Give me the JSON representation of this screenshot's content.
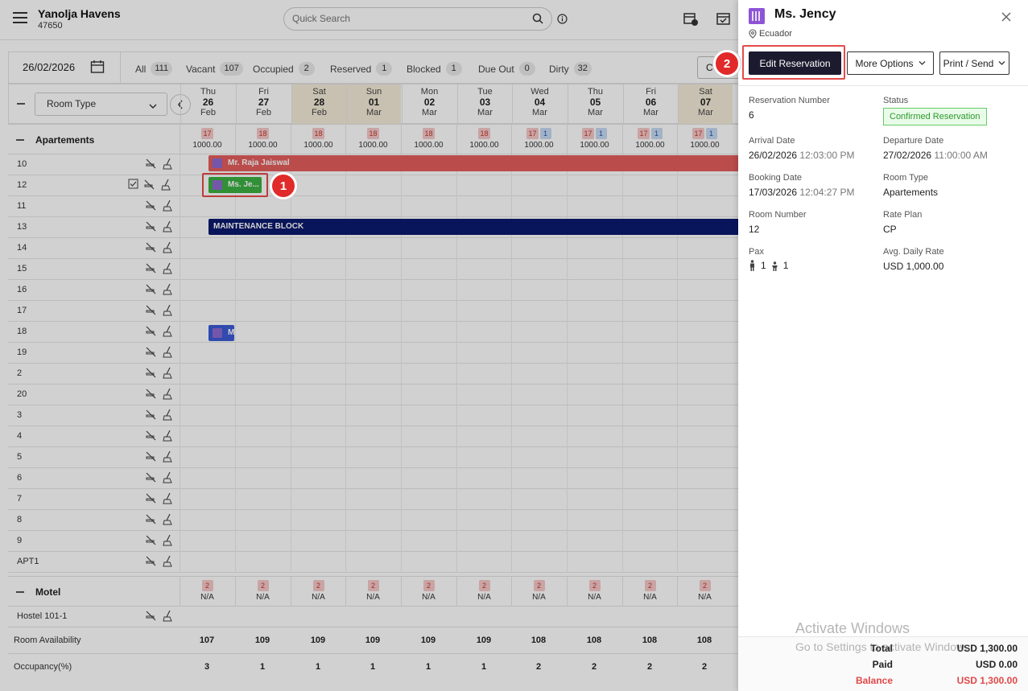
{
  "header": {
    "hotel_name": "Yanolja Havens",
    "hotel_code": "47650",
    "search_placeholder": "Quick Search"
  },
  "filters": {
    "date": "26/02/2026",
    "items": [
      {
        "label": "All",
        "count": "111"
      },
      {
        "label": "Vacant",
        "count": "107"
      },
      {
        "label": "Occupied",
        "count": "2"
      },
      {
        "label": "Reserved",
        "count": "1"
      },
      {
        "label": "Blocked",
        "count": "1"
      },
      {
        "label": "Due Out",
        "count": "0"
      },
      {
        "label": "Dirty",
        "count": "32"
      }
    ],
    "clipped_button": "C"
  },
  "grid": {
    "room_type_select": "Room Type",
    "dates": [
      {
        "dow": "Thu",
        "day": "26",
        "mon": "Feb"
      },
      {
        "dow": "Fri",
        "day": "27",
        "mon": "Feb"
      },
      {
        "dow": "Sat",
        "day": "28",
        "mon": "Feb"
      },
      {
        "dow": "Sun",
        "day": "01",
        "mon": "Mar"
      },
      {
        "dow": "Mon",
        "day": "02",
        "mon": "Mar"
      },
      {
        "dow": "Tue",
        "day": "03",
        "mon": "Mar"
      },
      {
        "dow": "Wed",
        "day": "04",
        "mon": "Mar"
      },
      {
        "dow": "Thu",
        "day": "05",
        "mon": "Mar"
      },
      {
        "dow": "Fri",
        "day": "06",
        "mon": "Mar"
      },
      {
        "dow": "Sat",
        "day": "07",
        "mon": "Mar"
      }
    ],
    "group1": {
      "name": "Apartements",
      "cells": [
        {
          "red": "17",
          "blue": "",
          "amt": "1000.00"
        },
        {
          "red": "18",
          "blue": "",
          "amt": "1000.00"
        },
        {
          "red": "18",
          "blue": "",
          "amt": "1000.00"
        },
        {
          "red": "18",
          "blue": "",
          "amt": "1000.00"
        },
        {
          "red": "18",
          "blue": "",
          "amt": "1000.00"
        },
        {
          "red": "18",
          "blue": "",
          "amt": "1000.00"
        },
        {
          "red": "17",
          "blue": "1",
          "amt": "1000.00"
        },
        {
          "red": "17",
          "blue": "1",
          "amt": "1000.00"
        },
        {
          "red": "17",
          "blue": "1",
          "amt": "1000.00"
        },
        {
          "red": "17",
          "blue": "1",
          "amt": "1000.00"
        }
      ]
    },
    "rooms": [
      "10",
      "12",
      "11",
      "13",
      "14",
      "15",
      "16",
      "17",
      "18",
      "19",
      "2",
      "20",
      "3",
      "4",
      "5",
      "6",
      "7",
      "8",
      "9",
      "APT1"
    ],
    "bookings": {
      "raja": "Mr. Raja Jaiswal",
      "jency": "Ms. Je...",
      "maintenance": "MAINTENANCE BLOCK",
      "room18": "M"
    },
    "group2": {
      "name": "Motel",
      "cells": [
        "2",
        "2",
        "2",
        "2",
        "2",
        "2",
        "2",
        "2",
        "2",
        "2"
      ],
      "value": "N/A"
    },
    "hostel_room": "Hostel 101-1",
    "availability_label": "Room Availability",
    "availability": [
      "107",
      "109",
      "109",
      "109",
      "109",
      "109",
      "108",
      "108",
      "108",
      "108"
    ],
    "occupancy_label": "Occupancy(%)",
    "occupancy": [
      "3",
      "1",
      "1",
      "1",
      "1",
      "1",
      "2",
      "2",
      "2",
      "2"
    ]
  },
  "panel": {
    "guest_name": "Ms. Jency",
    "country": "Ecuador",
    "buttons": {
      "edit": "Edit Reservation",
      "more": "More Options",
      "print": "Print / Send"
    },
    "fields": {
      "reservation_number_label": "Reservation Number",
      "reservation_number": "6",
      "status_label": "Status",
      "status": "Confirmed Reservation",
      "arrival_label": "Arrival Date",
      "arrival_date": "26/02/2026",
      "arrival_time": "12:03:00 PM",
      "departure_label": "Departure Date",
      "departure_date": "27/02/2026",
      "departure_time": "11:00:00 AM",
      "booking_label": "Booking Date",
      "booking_date": "17/03/2026",
      "booking_time": "12:04:27 PM",
      "room_type_label": "Room Type",
      "room_type": "Apartements",
      "room_number_label": "Room Number",
      "room_number": "12",
      "rate_plan_label": "Rate Plan",
      "rate_plan": "CP",
      "pax_label": "Pax",
      "pax_adults": "1",
      "pax_children": "1",
      "adr_label": "Avg. Daily Rate",
      "adr": "USD 1,000.00"
    },
    "totals": {
      "total_label": "Total",
      "total": "USD 1,300.00",
      "paid_label": "Paid",
      "paid": "USD 0.00",
      "balance_label": "Balance",
      "balance": "USD 1,300.00"
    }
  },
  "watermark": {
    "line1": "Activate Windows",
    "line2": "Go to Settings to activate Windows."
  },
  "steps": {
    "one": "1",
    "two": "2"
  },
  "colors": {
    "raja_bar": "#e35d5d",
    "jency_bar": "#3cb043",
    "maintenance_bar": "#0b1a6e",
    "room18_bar": "#3b5bd6",
    "edit_button": "#1b1a2e",
    "highlight": "#e34b4b"
  }
}
